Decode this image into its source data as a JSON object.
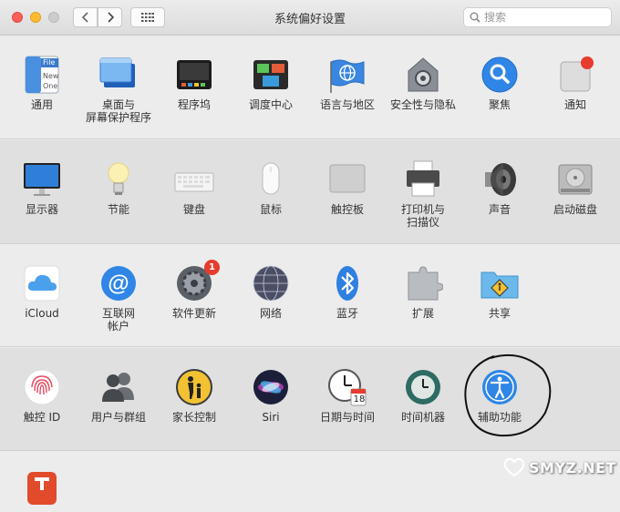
{
  "window": {
    "title": "系统偏好设置"
  },
  "search": {
    "placeholder": "搜索"
  },
  "rows": [
    [
      {
        "label": "通用",
        "icon": "general-icon",
        "doc_text": [
          "File",
          "New",
          "One"
        ]
      },
      {
        "label": "桌面与\n屏幕保护程序",
        "icon": "desktop-screensaver-icon"
      },
      {
        "label": "程序坞",
        "icon": "dock-icon"
      },
      {
        "label": "调度中心",
        "icon": "mission-control-icon"
      },
      {
        "label": "语言与地区",
        "icon": "language-region-icon"
      },
      {
        "label": "安全性与隐私",
        "icon": "security-privacy-icon"
      },
      {
        "label": "聚焦",
        "icon": "spotlight-icon"
      },
      {
        "label": "通知",
        "icon": "notifications-icon"
      }
    ],
    [
      {
        "label": "显示器",
        "icon": "displays-icon"
      },
      {
        "label": "节能",
        "icon": "energy-saver-icon"
      },
      {
        "label": "键盘",
        "icon": "keyboard-icon"
      },
      {
        "label": "鼠标",
        "icon": "mouse-icon"
      },
      {
        "label": "触控板",
        "icon": "trackpad-icon"
      },
      {
        "label": "打印机与\n扫描仪",
        "icon": "printers-scanners-icon"
      },
      {
        "label": "声音",
        "icon": "sound-icon"
      },
      {
        "label": "启动磁盘",
        "icon": "startup-disk-icon"
      }
    ],
    [
      {
        "label": "iCloud",
        "icon": "icloud-icon"
      },
      {
        "label": "互联网\n帐户",
        "icon": "internet-accounts-icon"
      },
      {
        "label": "软件更新",
        "icon": "software-update-icon",
        "badge": "1"
      },
      {
        "label": "网络",
        "icon": "network-icon"
      },
      {
        "label": "蓝牙",
        "icon": "bluetooth-icon"
      },
      {
        "label": "扩展",
        "icon": "extensions-icon"
      },
      {
        "label": "共享",
        "icon": "sharing-icon"
      }
    ],
    [
      {
        "label": "触控 ID",
        "icon": "touch-id-icon"
      },
      {
        "label": "用户与群组",
        "icon": "users-groups-icon"
      },
      {
        "label": "家长控制",
        "icon": "parental-controls-icon"
      },
      {
        "label": "Siri",
        "icon": "siri-icon"
      },
      {
        "label": "日期与时间",
        "icon": "date-time-icon",
        "cal_day": "18"
      },
      {
        "label": "时间机器",
        "icon": "time-machine-icon"
      },
      {
        "label": "辅助功能",
        "icon": "accessibility-icon"
      }
    ],
    [
      {
        "label": "",
        "icon": "third-party-pane-icon"
      }
    ]
  ],
  "watermark": {
    "text": "SMYZ.NET"
  },
  "colors": {
    "section_a": "#ececec",
    "section_b": "#e0e0e0",
    "divider": "#cfcfcf",
    "badge": "#e63b2e",
    "annotation": "#111111"
  }
}
